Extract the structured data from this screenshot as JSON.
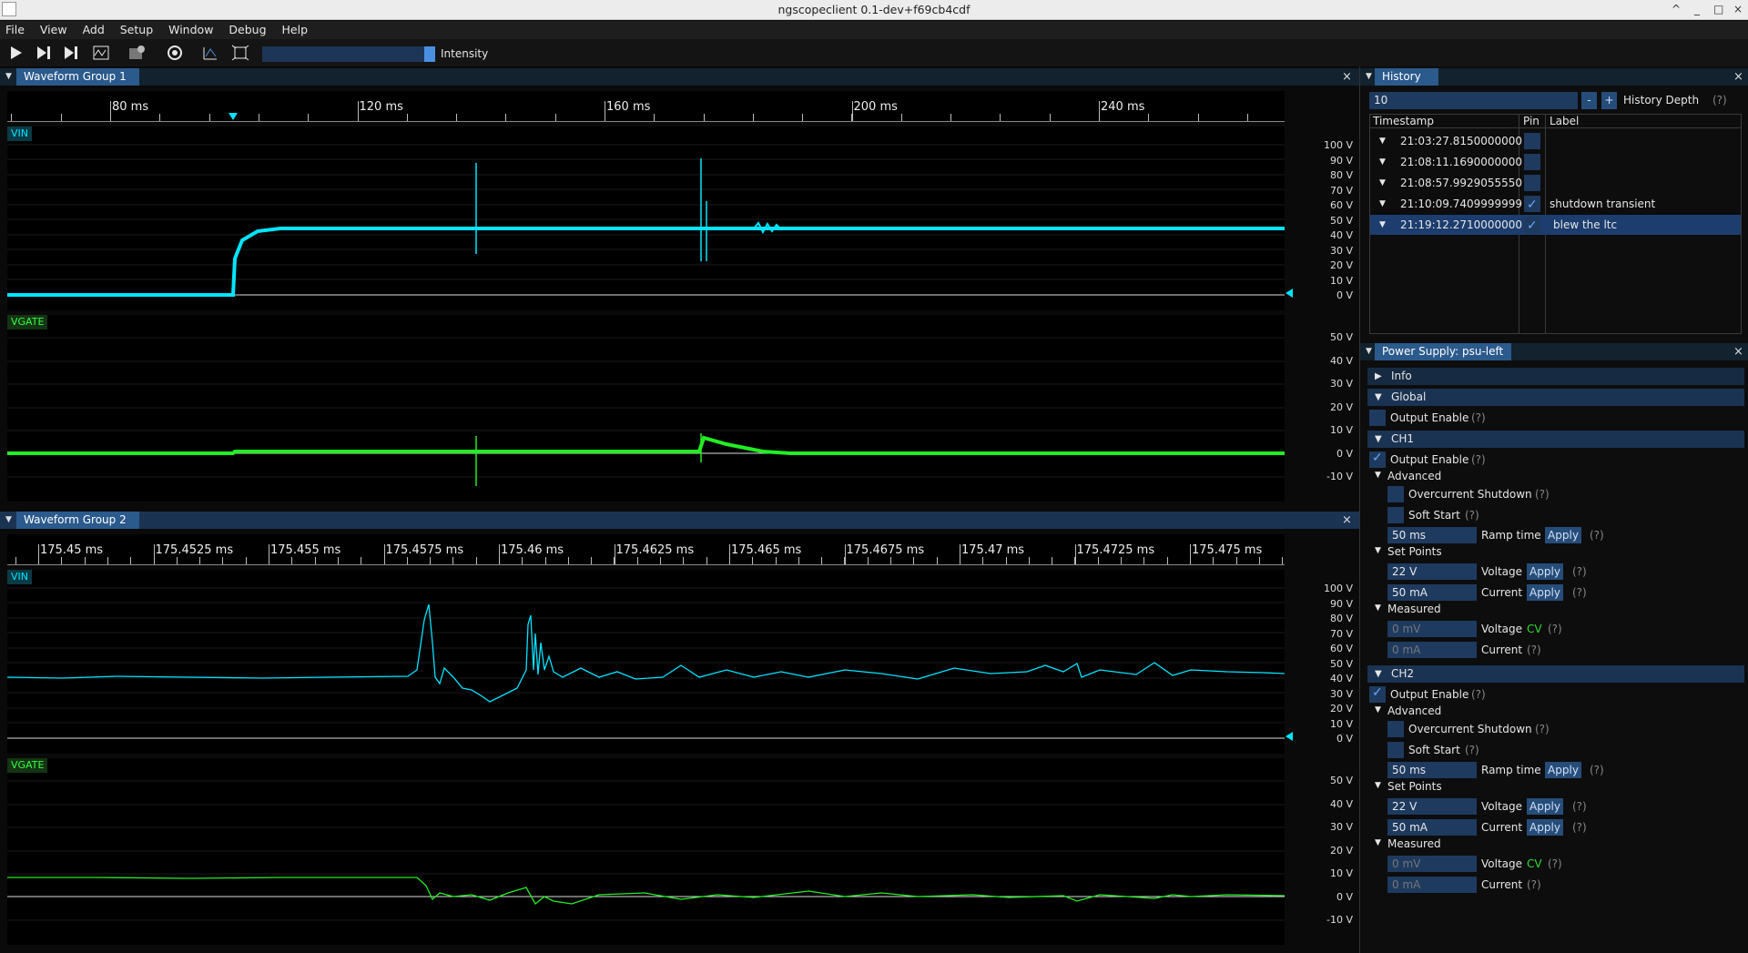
{
  "window": {
    "title": "ngscopeclient 0.1-dev+f69cb4cdf",
    "controls": [
      "^",
      "_",
      "□",
      "×"
    ]
  },
  "menu": [
    "File",
    "View",
    "Add",
    "Setup",
    "Window",
    "Debug",
    "Help"
  ],
  "toolbar": {
    "icons": [
      "run-icon",
      "run-single-icon",
      "run-force-icon",
      "auto-scale-icon",
      "add-instrument-icon",
      "settings-icon",
      "measure-icon",
      "fullscreen-icon"
    ],
    "intensity_label": "Intensity",
    "intensity": 1.0
  },
  "group1": {
    "title": "Waveform Group 1",
    "ruler": [
      "80 ms",
      "120 ms",
      "160 ms",
      "200 ms",
      "240 ms"
    ],
    "channels": [
      {
        "name": "VIN",
        "ylabels": [
          "100 V",
          "90 V",
          "80 V",
          "70 V",
          "60 V",
          "50 V",
          "40 V",
          "30 V",
          "20 V",
          "10 V",
          "0 V"
        ]
      },
      {
        "name": "VGATE",
        "ylabels": [
          "50 V",
          "40 V",
          "30 V",
          "20 V",
          "10 V",
          "0 V",
          "-10 V"
        ]
      }
    ]
  },
  "group2": {
    "title": "Waveform Group 2",
    "ruler": [
      "175.45 ms",
      "175.4525 ms",
      "175.455 ms",
      "175.4575 ms",
      "175.46 ms",
      "175.4625 ms",
      "175.465 ms",
      "175.4675 ms",
      "175.47 ms",
      "175.4725 ms",
      "175.475 ms"
    ],
    "channels": [
      {
        "name": "VIN",
        "ylabels": [
          "100 V",
          "90 V",
          "80 V",
          "70 V",
          "60 V",
          "50 V",
          "40 V",
          "30 V",
          "20 V",
          "10 V",
          "0 V"
        ]
      },
      {
        "name": "VGATE",
        "ylabels": [
          "50 V",
          "40 V",
          "30 V",
          "20 V",
          "10 V",
          "0 V",
          "-10 V"
        ]
      }
    ]
  },
  "history": {
    "title": "History",
    "depth_value": "10",
    "minus": "-",
    "plus": "+",
    "depth_label": "History Depth",
    "help": "(?)",
    "columns": [
      "Timestamp",
      "Pin",
      "Label"
    ],
    "rows": [
      {
        "ts": "21:03:27.8150000000",
        "pin": false,
        "label": ""
      },
      {
        "ts": "21:08:11.1690000000",
        "pin": false,
        "label": ""
      },
      {
        "ts": "21:08:57.9929055550",
        "pin": false,
        "label": ""
      },
      {
        "ts": "21:10:09.7409999999",
        "pin": true,
        "label": "shutdown transient"
      },
      {
        "ts": "21:19:12.2710000000",
        "pin": true,
        "label": "blew the ltc"
      }
    ]
  },
  "psu": {
    "title": "Power Supply: psu-left",
    "info": "Info",
    "global": "Global",
    "output_enable": "Output Enable",
    "help": "(?)",
    "ch1": {
      "name": "CH1",
      "advanced": "Advanced",
      "ocp": "Overcurrent Shutdown",
      "soft_start": "Soft Start",
      "ramp_value": "50 ms",
      "ramp_label": "Ramp time",
      "apply": "Apply",
      "setpoints": "Set Points",
      "v_set": "22 V",
      "i_set": "50 mA",
      "voltage": "Voltage",
      "current": "Current",
      "measured": "Measured",
      "v_meas": "0 mV",
      "i_meas": "0 mA",
      "mode": "CV"
    },
    "ch2": {
      "name": "CH2",
      "advanced": "Advanced",
      "ocp": "Overcurrent Shutdown",
      "soft_start": "Soft Start",
      "ramp_value": "50 ms",
      "ramp_label": "Ramp time",
      "apply": "Apply",
      "setpoints": "Set Points",
      "v_set": "22 V",
      "i_set": "50 mA",
      "voltage": "Voltage",
      "current": "Current",
      "measured": "Measured",
      "v_meas": "0 mV",
      "i_meas": "0 mA",
      "mode": "CV"
    }
  },
  "colors": {
    "vin": "#00e5ff",
    "vgate": "#22ee22",
    "tab": "#2b5a8c"
  }
}
